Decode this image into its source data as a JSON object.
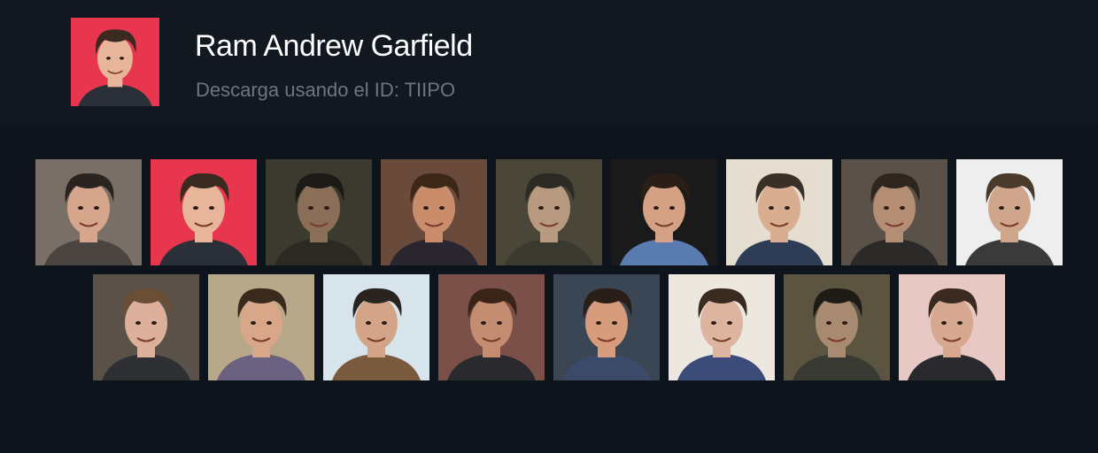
{
  "profile": {
    "name": "Ram Andrew Garfield",
    "subtitle": "Descarga usando el ID: TIIPO",
    "avatar": {
      "bg": "#e8364e",
      "hair": "#3a2a20",
      "skin": "#e6b59a",
      "shirt": "#2a2f38"
    }
  },
  "gallery": {
    "row1": [
      {
        "bg": "#7a6f66",
        "hair": "#2a2420",
        "skin": "#d6a68c",
        "shirt": "#4a4540"
      },
      {
        "bg": "#e8364e",
        "hair": "#3a2a20",
        "skin": "#e6b59a",
        "shirt": "#2a2f38"
      },
      {
        "bg": "#3b3a2e",
        "hair": "#1c1a16",
        "skin": "#8b6e58",
        "shirt": "#2a2a22"
      },
      {
        "bg": "#6a4a3a",
        "hair": "#3b2718",
        "skin": "#c98d6c",
        "shirt": "#2a2630"
      },
      {
        "bg": "#4a4638",
        "hair": "#2c2a22",
        "skin": "#b89a80",
        "shirt": "#3a3a30"
      },
      {
        "bg": "#1a1a1a",
        "hair": "#2a1e16",
        "skin": "#d4a184",
        "shirt": "#5a7bb0"
      },
      {
        "bg": "#e4ddd0",
        "hair": "#3a3028",
        "skin": "#d8ad90",
        "shirt": "#2e3c56"
      },
      {
        "bg": "#5a5248",
        "hair": "#2e261e",
        "skin": "#b48e74",
        "shirt": "#2c2a28"
      },
      {
        "bg": "#eeeeee",
        "hair": "#4a3a2c",
        "skin": "#cfa68c",
        "shirt": "#3a3a3a"
      }
    ],
    "row2": [
      {
        "bg": "#5a5248",
        "hair": "#6a4e36",
        "skin": "#dcb09a",
        "shirt": "#2e3034"
      },
      {
        "bg": "#b8a88a",
        "hair": "#3a2a1c",
        "skin": "#d8a688",
        "shirt": "#6a6080"
      },
      {
        "bg": "#d8e4ec",
        "hair": "#2a2420",
        "skin": "#d4a488",
        "shirt": "#7a5a3c"
      },
      {
        "bg": "#7a5048",
        "hair": "#3a2418",
        "skin": "#c48c70",
        "shirt": "#2a2a2e"
      },
      {
        "bg": "#3a4654",
        "hair": "#2a1e18",
        "skin": "#d69c7c",
        "shirt": "#3a4a68"
      },
      {
        "bg": "#ece8e0",
        "hair": "#3a2a20",
        "skin": "#dcb4a0",
        "shirt": "#3c4c7a"
      },
      {
        "bg": "#5a5440",
        "hair": "#1e1a16",
        "skin": "#a88a70",
        "shirt": "#3a3a34"
      },
      {
        "bg": "#e8c8c4",
        "hair": "#3a2a20",
        "skin": "#d6a890",
        "shirt": "#2a2a2e"
      }
    ]
  }
}
